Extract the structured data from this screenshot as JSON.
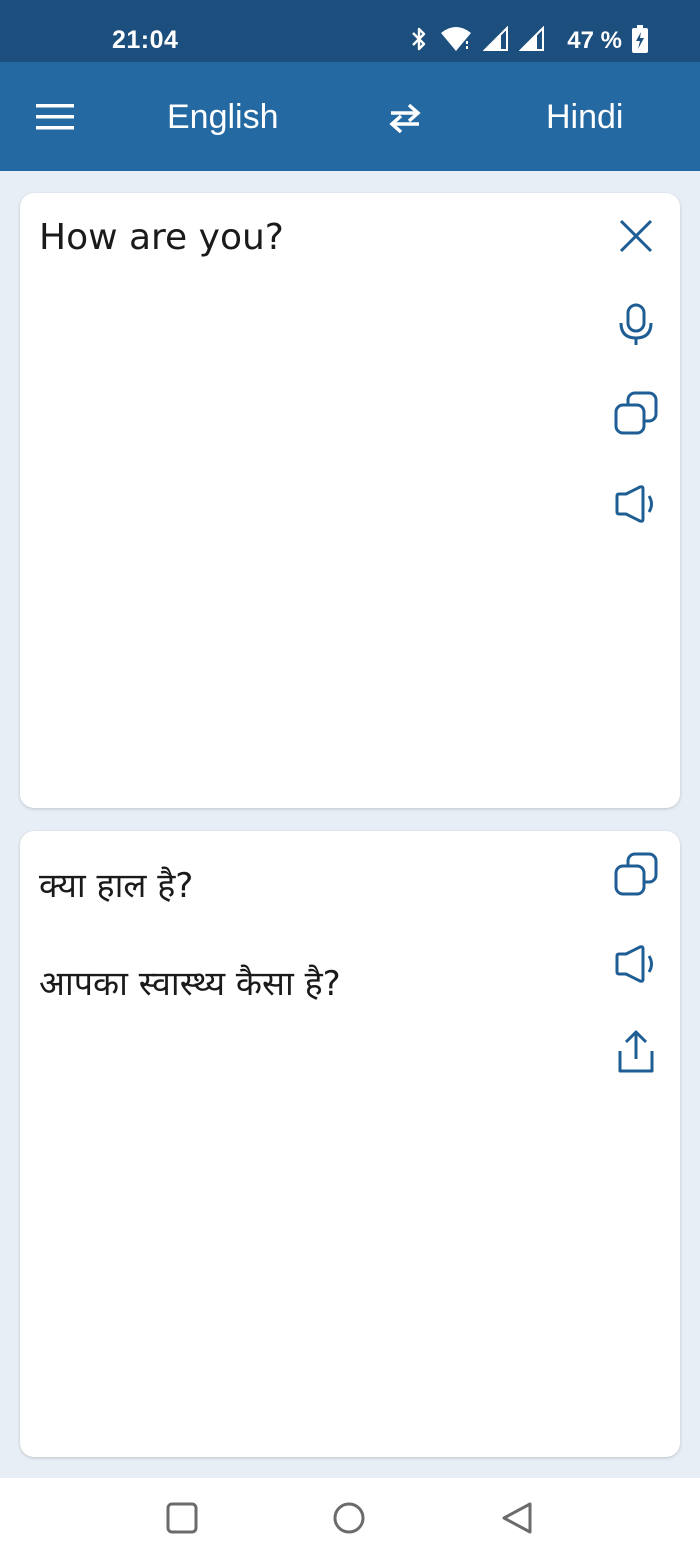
{
  "status_bar": {
    "time": "21:04",
    "battery": "47 %",
    "icons": [
      "bluetooth-icon",
      "wifi-icon",
      "signal-icon",
      "signal-icon",
      "battery-charging-icon"
    ]
  },
  "toolbar": {
    "source_language": "English",
    "target_language": "Hindi",
    "icons": [
      "menu-icon",
      "swap-icon"
    ]
  },
  "input_card": {
    "text": "How are you?",
    "icons": [
      "close-icon",
      "microphone-icon",
      "copy-icon",
      "speaker-icon"
    ]
  },
  "output_card": {
    "lines": [
      "क्या हाल है?",
      "आपका स्वास्थ्य कैसा है?"
    ],
    "icons": [
      "copy-icon",
      "speaker-icon",
      "share-icon"
    ]
  },
  "nav_bar": {
    "icons": [
      "recents-icon",
      "home-icon",
      "back-icon"
    ]
  },
  "colors": {
    "status_bar": "#1c4f7d",
    "toolbar": "#2469a1",
    "background": "#e8eef6",
    "accent_icon": "#1f5e95"
  }
}
